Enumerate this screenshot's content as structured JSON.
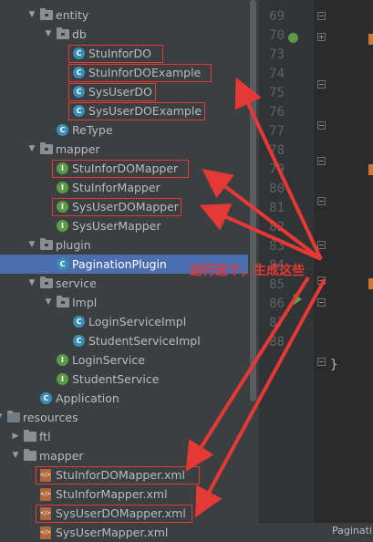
{
  "project_tree": {
    "rows": [
      {
        "label": "entity",
        "icon": "package-folder-icon",
        "arrow": "▼",
        "type": "folder"
      },
      {
        "label": "db",
        "icon": "package-folder-icon",
        "arrow": "▼",
        "type": "folder"
      },
      {
        "label": "StuInforDO",
        "icon": "class-icon",
        "arrow": "",
        "type": "class",
        "highlighted": true
      },
      {
        "label": "StuInforDOExample",
        "icon": "class-icon",
        "arrow": "",
        "type": "class",
        "highlighted": true
      },
      {
        "label": "SysUserDO",
        "icon": "class-icon",
        "arrow": "",
        "type": "class",
        "highlighted": true
      },
      {
        "label": "SysUserDOExample",
        "icon": "class-icon",
        "arrow": "",
        "type": "class",
        "highlighted": true
      },
      {
        "label": "ReType",
        "icon": "class-icon",
        "arrow": "",
        "type": "class"
      },
      {
        "label": "mapper",
        "icon": "package-folder-icon",
        "arrow": "▼",
        "type": "folder"
      },
      {
        "label": "StuInforDOMapper",
        "icon": "interface-icon",
        "arrow": "",
        "type": "interface",
        "highlighted": true
      },
      {
        "label": "StuInforMapper",
        "icon": "interface-icon",
        "arrow": "",
        "type": "interface"
      },
      {
        "label": "SysUserDOMapper",
        "icon": "interface-icon",
        "arrow": "",
        "type": "interface",
        "highlighted": true
      },
      {
        "label": "SysUserMapper",
        "icon": "interface-icon",
        "arrow": "",
        "type": "interface"
      },
      {
        "label": "plugin",
        "icon": "package-folder-icon",
        "arrow": "▼",
        "type": "folder"
      },
      {
        "label": "PaginationPlugin",
        "icon": "class-icon",
        "arrow": "",
        "type": "class",
        "selected": true
      },
      {
        "label": "service",
        "icon": "package-folder-icon",
        "arrow": "▼",
        "type": "folder"
      },
      {
        "label": "Impl",
        "icon": "package-folder-icon",
        "arrow": "▼",
        "type": "folder"
      },
      {
        "label": "LoginServiceImpl",
        "icon": "class-icon",
        "arrow": "",
        "type": "class"
      },
      {
        "label": "StudentServiceImpl",
        "icon": "class-icon",
        "arrow": "",
        "type": "class"
      },
      {
        "label": "LoginService",
        "icon": "interface-icon",
        "arrow": "",
        "type": "interface"
      },
      {
        "label": "StudentService",
        "icon": "interface-icon",
        "arrow": "",
        "type": "interface"
      },
      {
        "label": "Application",
        "icon": "spring-app-icon",
        "arrow": "",
        "type": "app"
      },
      {
        "label": "resources",
        "icon": "resources-folder-icon",
        "arrow": "▼",
        "type": "res"
      },
      {
        "label": "ftl",
        "icon": "folder-icon",
        "arrow": "▶",
        "type": "folder"
      },
      {
        "label": "mapper",
        "icon": "folder-icon",
        "arrow": "▼",
        "type": "folder"
      },
      {
        "label": "StuInforDOMapper.xml",
        "icon": "xml-file-icon",
        "arrow": "",
        "type": "xml",
        "highlighted": true
      },
      {
        "label": "StuInforMapper.xml",
        "icon": "xml-file-icon",
        "arrow": "",
        "type": "xml"
      },
      {
        "label": "SysUserDOMapper.xml",
        "icon": "xml-file-icon",
        "arrow": "",
        "type": "xml",
        "highlighted": true
      },
      {
        "label": "SysUserMapper.xml",
        "icon": "xml-file-icon",
        "arrow": "",
        "type": "xml"
      }
    ]
  },
  "annotation": {
    "text": "运行这个，生成这些",
    "color": "#e53935"
  },
  "editor": {
    "line_numbers": [
      "69",
      "70",
      "73",
      "74",
      "75",
      "76",
      "77",
      "78",
      "79",
      "80",
      "81",
      "82",
      "83",
      "84",
      "85",
      "86",
      "87",
      "88"
    ],
    "closing_brace": "}",
    "tab_label": "Paginati"
  },
  "colors": {
    "selection": "#4b6eaf",
    "highlight_box": "#e53935",
    "panel_bg": "#3c3f41",
    "editor_bg": "#2b2b2b"
  }
}
